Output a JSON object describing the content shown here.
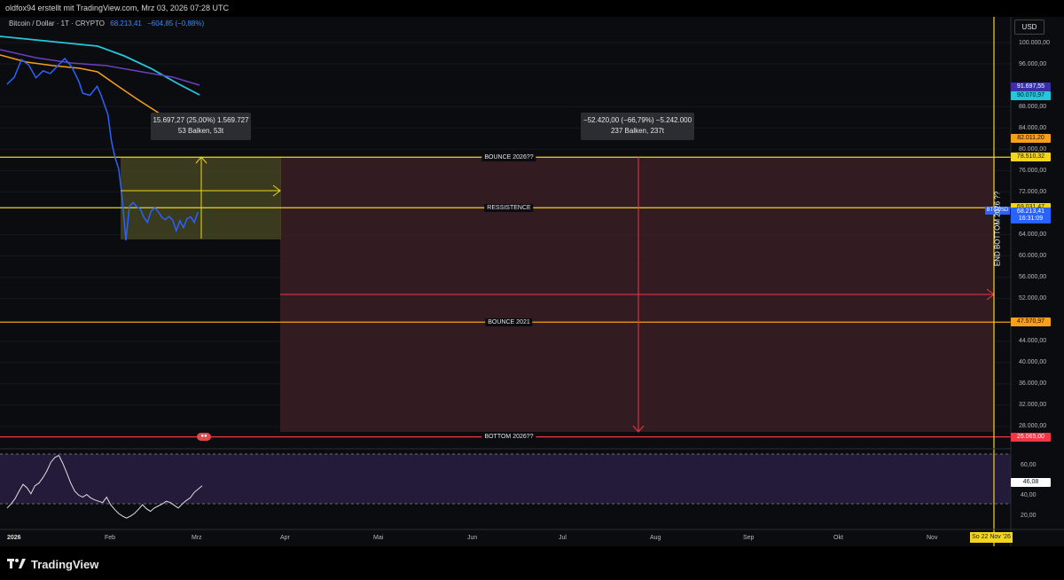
{
  "header": {
    "caption": "oldfox94 erstellt mit TradingView.com, Mrz 03, 2026 07:28 UTC"
  },
  "symbol": {
    "name": "Bitcoin / Dollar · 1T · CRYPTO",
    "price": "68.213,41",
    "change": "−604,85 (−0,88%)"
  },
  "currency": "USD",
  "measure_boxes": [
    {
      "line1": "15.697,27 (25,00%) 1.569.727",
      "line2": "53 Balken, 53t"
    },
    {
      "line1": "−52.420,00 (−66,79%) −5.242.000",
      "line2": "237 Balken, 237t"
    }
  ],
  "h_lines": [
    {
      "label": "BOUNCE 2026??",
      "price": 78510.32,
      "color": "#f2d51f"
    },
    {
      "label": "RESSISTENCE",
      "price": 69031.47,
      "color": "#f2d51f"
    },
    {
      "label": "BOUNCE 2021",
      "price": 47570.97,
      "color": "#f59f1a"
    },
    {
      "label": "BOTTOM 2026??",
      "price": 26065.0,
      "color": "#f23645"
    }
  ],
  "price_axis": [
    "100.000,00",
    "96.000,00",
    "88.000,00",
    "84.000,00",
    "80.000,00",
    "76.000,00",
    "72.000,00",
    "64.000,00",
    "60.000,00",
    "56.000,00",
    "52.000,00",
    "44.000,00",
    "40.000,00",
    "36.000,00",
    "32.000,00",
    "28.000,00"
  ],
  "price_tags": [
    {
      "text": "91.697,55",
      "bg": "#3b2fa8",
      "fg": "#ffffff",
      "price": 91697.55
    },
    {
      "text": "90.070,97",
      "bg": "#26c6da",
      "fg": "#001418",
      "price": 90070.97
    },
    {
      "text": "82.011,20",
      "bg": "#f59f1a",
      "fg": "#1a1000",
      "price": 82011.2
    },
    {
      "text": "78.510,32",
      "bg": "#f2d51f",
      "fg": "#1a1800",
      "price": 78510.32
    },
    {
      "text": "69.031,47",
      "bg": "#f2d51f",
      "fg": "#1a1800",
      "price": 69031.47
    },
    {
      "text": "68.213,41",
      "bg": "#2962ff",
      "fg": "#ffffff",
      "price": 68213.41
    },
    {
      "text": "16:31:09",
      "bg": "#2962ff",
      "fg": "#ffffff",
      "price": 66850
    },
    {
      "text": "47.570,97",
      "bg": "#f59f1a",
      "fg": "#1a1000",
      "price": 47570.97
    },
    {
      "text": "26.065,00",
      "bg": "#f23645",
      "fg": "#ffffff",
      "price": 26065.0
    }
  ],
  "symbol_tag": "BTCUSD",
  "rsi": {
    "ticks": [
      "60,00",
      "40,00",
      "20,00"
    ],
    "value": "46,08"
  },
  "time_axis": [
    "2026",
    "Feb",
    "Mrz",
    "Apr",
    "Mai",
    "Jun",
    "Jul",
    "Aug",
    "Sep",
    "Okt",
    "Nov"
  ],
  "date_badge": "So 22 Nov '26",
  "vertical_label": "END BOTTOM 2026 ??",
  "brand": "TradingView",
  "colors": {
    "price_line": "#2962ff",
    "ma_cyan": "#26c6da",
    "ma_purple": "#6a3fc0",
    "ma_orange": "#f59f1a",
    "bg": "#0b0c0f"
  },
  "icons": {
    "event": "flag-us-icon",
    "brand": "tradingview-logo-icon"
  },
  "rsi_series": [
    0.2,
    0.26,
    0.34,
    0.45,
    0.55,
    0.5,
    0.41,
    0.53,
    0.57,
    0.65,
    0.75,
    0.88,
    0.95,
    0.98,
    0.86,
    0.72,
    0.57,
    0.45,
    0.39,
    0.36,
    0.4,
    0.35,
    0.32,
    0.3,
    0.28,
    0.36,
    0.25,
    0.18,
    0.12,
    0.08,
    0.05,
    0.08,
    0.12,
    0.18,
    0.25,
    0.19,
    0.15,
    0.2,
    0.23,
    0.26,
    0.3,
    0.28,
    0.24,
    0.2,
    0.26,
    0.31,
    0.35,
    0.43,
    0.48,
    0.53
  ],
  "price_series": [
    {
      "d": 0,
      "p": 92200
    },
    {
      "d": 2,
      "p": 93500
    },
    {
      "d": 4,
      "p": 96800
    },
    {
      "d": 6,
      "p": 95800
    },
    {
      "d": 8,
      "p": 93400
    },
    {
      "d": 10,
      "p": 94700
    },
    {
      "d": 12,
      "p": 94200
    },
    {
      "d": 14,
      "p": 95600
    },
    {
      "d": 16,
      "p": 97000
    },
    {
      "d": 18,
      "p": 95400
    },
    {
      "d": 20,
      "p": 92600
    },
    {
      "d": 21,
      "p": 90500
    },
    {
      "d": 23,
      "p": 90100
    },
    {
      "d": 25,
      "p": 91800
    },
    {
      "d": 26,
      "p": 90300
    },
    {
      "d": 28,
      "p": 86500
    },
    {
      "d": 29,
      "p": 81500
    },
    {
      "d": 30,
      "p": 78400
    },
    {
      "d": 31,
      "p": 76300
    },
    {
      "d": 32,
      "p": 70700
    },
    {
      "d": 33,
      "p": 62900
    },
    {
      "d": 34,
      "p": 69300
    },
    {
      "d": 35,
      "p": 70000
    },
    {
      "d": 36,
      "p": 69200
    },
    {
      "d": 37,
      "p": 68800
    },
    {
      "d": 38,
      "p": 67200
    },
    {
      "d": 39,
      "p": 66300
    },
    {
      "d": 40,
      "p": 68400
    },
    {
      "d": 41,
      "p": 69000
    },
    {
      "d": 42,
      "p": 68300
    },
    {
      "d": 43,
      "p": 67200
    },
    {
      "d": 44,
      "p": 66800
    },
    {
      "d": 45,
      "p": 67400
    },
    {
      "d": 46,
      "p": 66700
    },
    {
      "d": 47,
      "p": 64700
    },
    {
      "d": 48,
      "p": 66600
    },
    {
      "d": 49,
      "p": 65300
    },
    {
      "d": 50,
      "p": 67000
    },
    {
      "d": 51,
      "p": 67300
    },
    {
      "d": 52,
      "p": 66300
    },
    {
      "d": 53,
      "p": 68200
    }
  ]
}
